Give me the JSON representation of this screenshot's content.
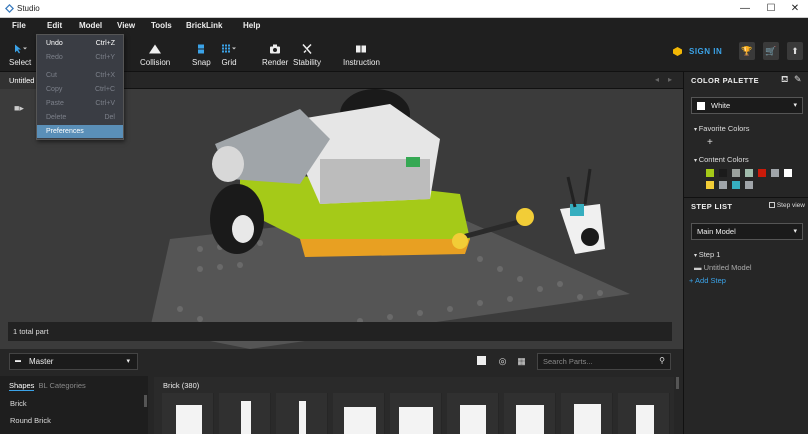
{
  "window": {
    "title": "Studio",
    "min": "—",
    "max": "☐",
    "close": "✕"
  },
  "menu": [
    "File",
    "Edit",
    "Model",
    "View",
    "Tools",
    "BrickLink",
    "Help"
  ],
  "edit_menu": [
    {
      "label": "Undo",
      "shortcut": "Ctrl+Z",
      "enabled": true
    },
    {
      "label": "Redo",
      "shortcut": "Ctrl+Y",
      "enabled": false
    },
    {
      "label": "Cut",
      "shortcut": "Ctrl+X",
      "enabled": false
    },
    {
      "label": "Copy",
      "shortcut": "Ctrl+C",
      "enabled": false
    },
    {
      "label": "Paste",
      "shortcut": "Ctrl+V",
      "enabled": false
    },
    {
      "label": "Delete",
      "shortcut": "Del",
      "enabled": false
    },
    {
      "label": "Preferences",
      "shortcut": "",
      "enabled": true,
      "highlighted": true
    }
  ],
  "toolbar": {
    "select": "Select",
    "collision": "Collision",
    "snap": "Snap",
    "grid": "Grid",
    "render": "Render",
    "stability": "Stability",
    "instruction": "Instruction",
    "sign_in": "SIGN IN"
  },
  "tab": {
    "label": "Untitled"
  },
  "status": {
    "total": "1 total part"
  },
  "parts_panel": {
    "set_dropdown": "Master",
    "search_placeholder": "Search Parts...",
    "tab_shapes": "Shapes",
    "tab_bl": "BL Categories",
    "categories": [
      "Brick",
      "Round Brick"
    ],
    "part_group": "Brick (380)"
  },
  "color_palette": {
    "header": "COLOR PALETTE",
    "selected": "White",
    "favorite_label": "Favorite Colors",
    "add": "+",
    "content_label": "Content Colors",
    "content_colors": [
      "#a5ca18",
      "#1b1b1b",
      "#9ba19d",
      "#a0bcac",
      "#c91a09",
      "#a0a5a9",
      "#ffffff",
      "#f2cd37",
      "#a0a5a9",
      "#36aebf",
      "#a0a5a9"
    ]
  },
  "step_list": {
    "header": "STEP LIST",
    "stepview": "Step view",
    "model_dropdown": "Main Model",
    "step": "Step 1",
    "model_item": "Untitled Model",
    "add_step": "+ Add Step"
  },
  "colors": {
    "accent": "#3ba3e8",
    "highlight": "#5a8fb8"
  }
}
